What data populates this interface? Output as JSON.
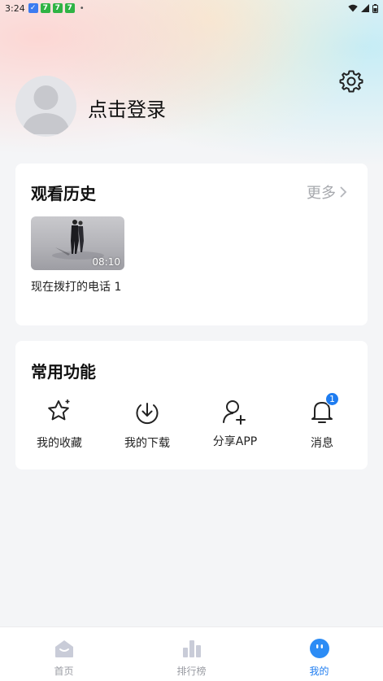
{
  "status_bar": {
    "time": "3:24"
  },
  "profile": {
    "login_label": "点击登录"
  },
  "history": {
    "title": "观看历史",
    "more_label": "更多",
    "items": [
      {
        "title": "现在拨打的电话 1",
        "duration": "08:10"
      }
    ]
  },
  "functions": {
    "title": "常用功能",
    "items": [
      {
        "label": "我的收藏",
        "icon": "star-icon"
      },
      {
        "label": "我的下载",
        "icon": "download-icon"
      },
      {
        "label": "分享APP",
        "icon": "share-user-icon"
      },
      {
        "label": "消息",
        "icon": "bell-icon",
        "badge": "1"
      }
    ]
  },
  "bottom_nav": {
    "items": [
      {
        "label": "首页",
        "icon": "home-icon",
        "active": false
      },
      {
        "label": "排行榜",
        "icon": "ranking-icon",
        "active": false
      },
      {
        "label": "我的",
        "icon": "profile-icon",
        "active": true
      }
    ]
  },
  "colors": {
    "accent": "#1e7cf0",
    "background": "#f4f5f7",
    "muted": "#a6a8ad"
  }
}
